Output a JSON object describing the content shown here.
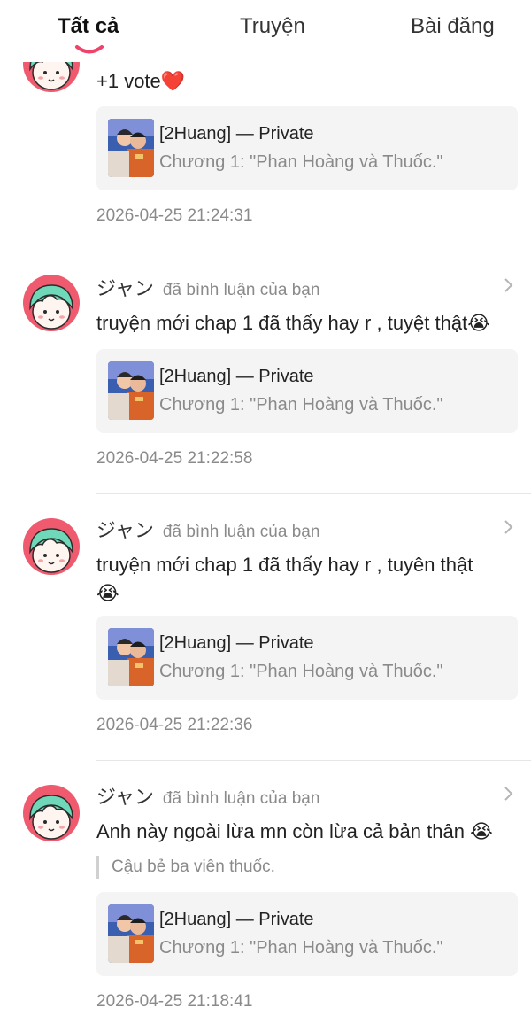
{
  "tabs": [
    {
      "label": "Tất cả"
    },
    {
      "label": "Truyện"
    },
    {
      "label": "Bài đăng"
    }
  ],
  "story": {
    "title": "[2Huang] — Private",
    "chapter": "Chương 1: \"Phan Hoàng và Thuốc.\""
  },
  "items": [
    {
      "comment": "+1 vote",
      "comment_emoji": "❤️",
      "time": "2026-04-25 21:24:31"
    },
    {
      "user": "ジャン",
      "action": "đã bình luận của bạn",
      "comment": "truyện mới chap 1 đã thấy hay r , tuyệt thật",
      "comment_emoji": "😭",
      "time": "2026-04-25 21:22:58"
    },
    {
      "user": "ジャン",
      "action": "đã bình luận của bạn",
      "comment": "truyện mới chap 1 đã thấy hay r , tuyên thật",
      "comment_emoji": "😭",
      "time": "2026-04-25 21:22:36"
    },
    {
      "user": "ジャン",
      "action": "đã bình luận của bạn",
      "comment": "Anh này ngoài lừa mn còn lừa cả bản thân",
      "comment_emoji": "😭",
      "quote": "Cậu bẻ ba viên thuốc.",
      "time": "2026-04-25 21:18:41"
    }
  ],
  "colors": {
    "accent": "#f0436a",
    "avatar_bg": "#ef5a6e",
    "avatar_hair": "#6fd8b8"
  }
}
